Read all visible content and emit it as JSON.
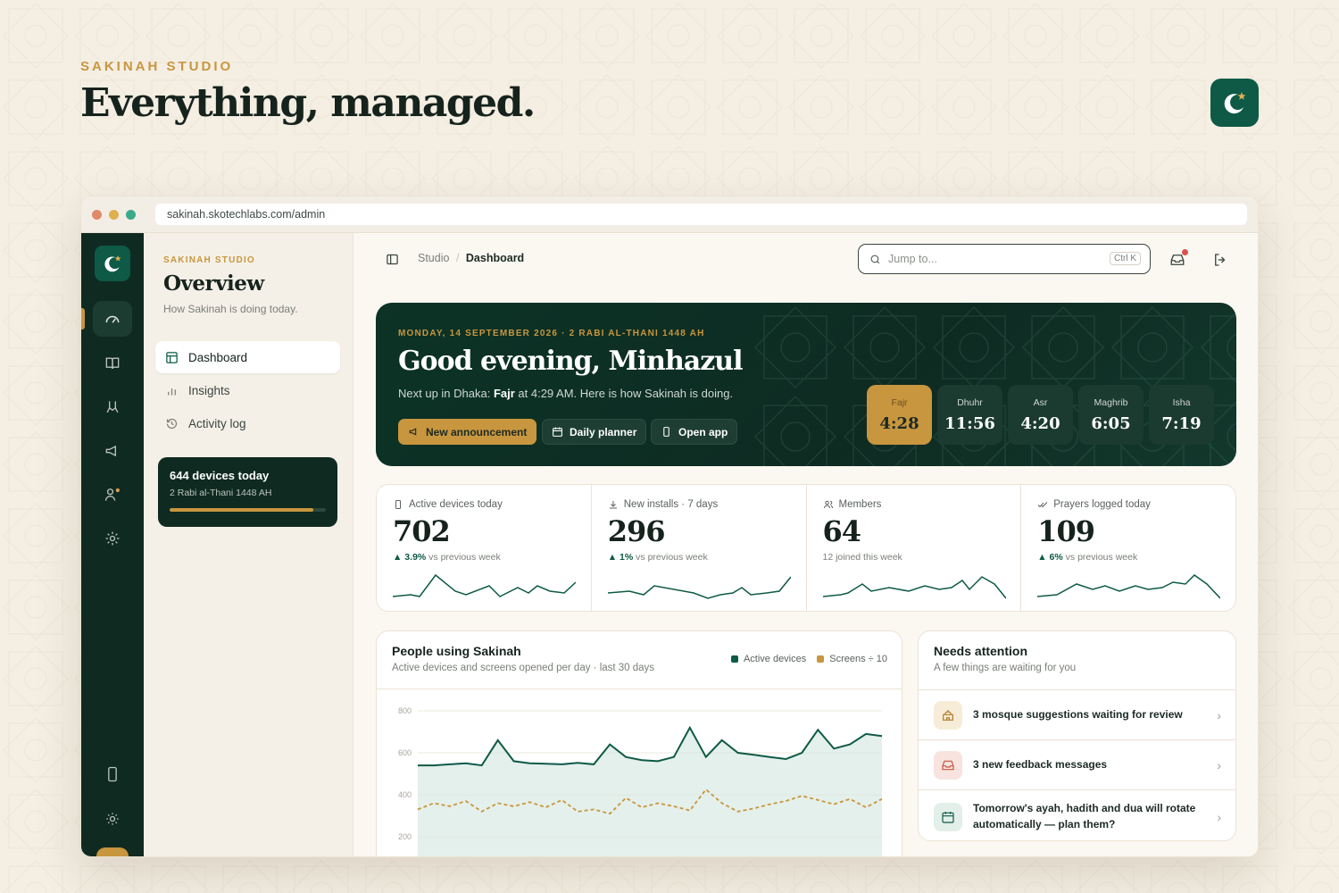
{
  "hero": {
    "eyebrow": "SAKINAH STUDIO",
    "title": "Everything, managed."
  },
  "browser": {
    "url": "sakinah.skotechlabs.com/admin"
  },
  "sidebar": {
    "eyebrow": "SAKINAH STUDIO",
    "title": "Overview",
    "subtitle": "How Sakinah is doing today.",
    "items": [
      {
        "label": "Dashboard",
        "icon": "layout-icon",
        "active": true
      },
      {
        "label": "Insights",
        "icon": "bar-chart-icon",
        "active": false
      },
      {
        "label": "Activity log",
        "icon": "history-icon",
        "active": false
      }
    ],
    "devices_card": {
      "title": "644 devices today",
      "subtitle": "2 Rabi al-Thani 1448 AH",
      "progress": 0.92
    }
  },
  "rail": {
    "icons": [
      "gauge-icon",
      "book-icon",
      "hands-icon",
      "megaphone-icon",
      "users-icon",
      "settings-icon",
      "phone-icon",
      "sun-icon"
    ]
  },
  "topbar": {
    "breadcrumb_root": "Studio",
    "breadcrumb_sep": "/",
    "breadcrumb_current": "Dashboard",
    "search_placeholder": "Jump to...",
    "search_shortcut": "Ctrl K"
  },
  "greeting": {
    "date": "MONDAY, 14 SEPTEMBER 2026 · 2 RABI AL-THANI 1448 AH",
    "title": "Good evening, Minhazul",
    "sub_prefix": "Next up in Dhaka: ",
    "sub_prayer": "Fajr",
    "sub_suffix": " at 4:29 AM. Here is how Sakinah is doing.",
    "buttons": {
      "announcement": "New announcement",
      "planner": "Daily planner",
      "open_app": "Open app"
    },
    "prayers": [
      {
        "name": "Fajr",
        "time": "4:28",
        "active": true
      },
      {
        "name": "Dhuhr",
        "time": "11:56",
        "active": false
      },
      {
        "name": "Asr",
        "time": "4:20",
        "active": false
      },
      {
        "name": "Maghrib",
        "time": "6:05",
        "active": false
      },
      {
        "name": "Isha",
        "time": "7:19",
        "active": false
      }
    ]
  },
  "stats": [
    {
      "label": "Active devices today",
      "value": "702",
      "delta": "▲ 3.9%",
      "delta_text": " vs previous week",
      "icon": "phone-icon"
    },
    {
      "label": "New installs · 7 days",
      "value": "296",
      "delta": "▲ 1%",
      "delta_text": " vs previous week",
      "icon": "download-icon"
    },
    {
      "label": "Members",
      "value": "64",
      "delta": "",
      "delta_text": "12 joined this week",
      "icon": "users-icon"
    },
    {
      "label": "Prayers logged today",
      "value": "109",
      "delta": "▲ 6%",
      "delta_text": " vs previous week",
      "icon": "check-check-icon"
    }
  ],
  "people_card": {
    "title": "People using Sakinah",
    "subtitle": "Active devices and screens opened per day · last 30 days",
    "legend_active": "Active devices",
    "legend_screens": "Screens ÷ 10"
  },
  "attention": {
    "title": "Needs attention",
    "subtitle": "A few things are waiting for you",
    "items": [
      {
        "text": "3 mosque suggestions waiting for review",
        "icon": "mosque-icon"
      },
      {
        "text": "3 new feedback messages",
        "icon": "inbox-icon"
      },
      {
        "text": "Tomorrow's ayah, hadith and dua will rotate automatically — plan them?",
        "icon": "calendar-icon"
      }
    ]
  },
  "colors": {
    "brand_green": "#0e5a46",
    "dark_green": "#0f2a21",
    "gold": "#c8963e",
    "cream": "#f4eee3"
  },
  "chart_data": {
    "type": "line",
    "title": "People using Sakinah",
    "ylim": [
      200,
      800
    ],
    "yticks": [
      800,
      600,
      400,
      200
    ],
    "series": [
      {
        "name": "Active devices",
        "values": [
          540,
          540,
          545,
          550,
          540,
          660,
          560,
          550,
          548,
          545,
          552,
          545,
          640,
          580,
          565,
          560,
          580,
          720,
          580,
          660,
          600,
          590,
          580,
          570,
          600,
          710,
          620,
          640,
          690,
          680
        ]
      },
      {
        "name": "Screens ÷ 10",
        "values": [
          330,
          360,
          345,
          370,
          320,
          360,
          345,
          365,
          340,
          375,
          320,
          330,
          310,
          385,
          340,
          360,
          345,
          325,
          425,
          360,
          320,
          335,
          355,
          370,
          395,
          375,
          355,
          380,
          340,
          380
        ]
      }
    ]
  }
}
